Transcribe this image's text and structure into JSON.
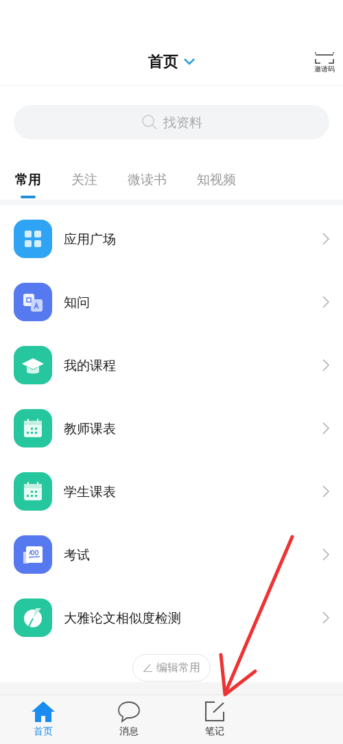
{
  "header": {
    "title": "首页",
    "invite_label": "邀请码"
  },
  "search": {
    "placeholder": "找资料"
  },
  "tabs": [
    {
      "label": "常用",
      "selected": true
    },
    {
      "label": "关注",
      "selected": false
    },
    {
      "label": "微读书",
      "selected": false
    },
    {
      "label": "知视频",
      "selected": false
    }
  ],
  "items": [
    {
      "label": "应用广场",
      "kind": "grid",
      "color": "#2fa4f5"
    },
    {
      "label": "知问",
      "kind": "qa",
      "color": "#5779ef"
    },
    {
      "label": "我的课程",
      "kind": "cap",
      "color": "#26c79e"
    },
    {
      "label": "教师课表",
      "kind": "calendar",
      "color": "#26c79e"
    },
    {
      "label": "学生课表",
      "kind": "calendar",
      "color": "#26c79e"
    },
    {
      "label": "考试",
      "kind": "score",
      "color": "#5779ef"
    },
    {
      "label": "大雅论文相似度检测",
      "kind": "pie",
      "color": "#26c79e"
    }
  ],
  "edit_button": {
    "label": "编辑常用"
  },
  "bottom_nav": [
    {
      "label": "首页",
      "kind": "home",
      "selected": true
    },
    {
      "label": "消息",
      "kind": "message",
      "selected": false
    },
    {
      "label": "笔记",
      "kind": "note",
      "selected": false
    }
  ]
}
